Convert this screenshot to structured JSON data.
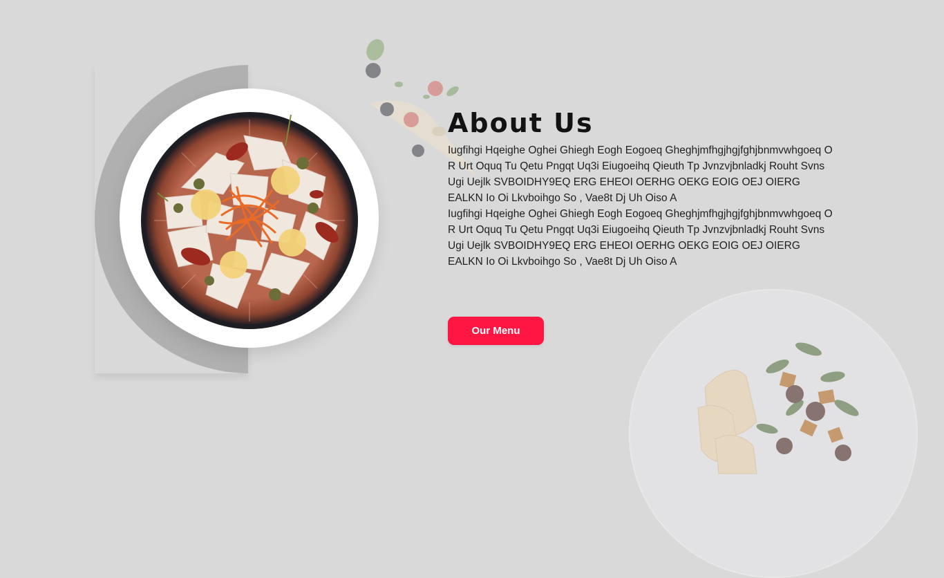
{
  "about": {
    "title": "About Us",
    "paragraphs": [
      "Iugfihgi Hqeighe Oghei Ghiegh Eogh Eogoeq Gheghjmfhgjhgjfghjbnmvwhgoeq O R Urt Oquq Tu Qetu Pngqt  Uq3i Eiugoeihq Qieuth Tp Jvnzvjbnladkj Rouht Svns Ugi Uejlk SVBOIDHY9EQ  ERG EHEOI OERHG OEKG EOIG OEJ OIERG EALKN Io Oi Lkvboihgo So , Vae8t Dj Uh Oiso A",
      "Iugfihgi Hqeighe Oghei Ghiegh Eogh Eogoeq Gheghjmfhgjhgjfghjbnmvwhgoeq O R Urt Oquq Tu Qetu Pngqt  Uq3i Eiugoeihq Qieuth Tp Jvnzvjbnladkj Rouht Svns Ugi Uejlk SVBOIDHY9EQ  ERG EHEOI OERHG OEKG EOIG OEJ OIERG EALKN Io Oi Lkvboihgo So , Vae8t Dj Uh Oiso A"
    ],
    "button_label": "Our Menu"
  },
  "colors": {
    "background": "#d9d9d9",
    "accent": "#ff1744",
    "arc": "#b0b0b0"
  },
  "images": {
    "main_plate": "plate-with-carpaccio-image",
    "pizza_decoration": "pizza-slice-image",
    "salad_decoration": "salad-plate-image"
  }
}
